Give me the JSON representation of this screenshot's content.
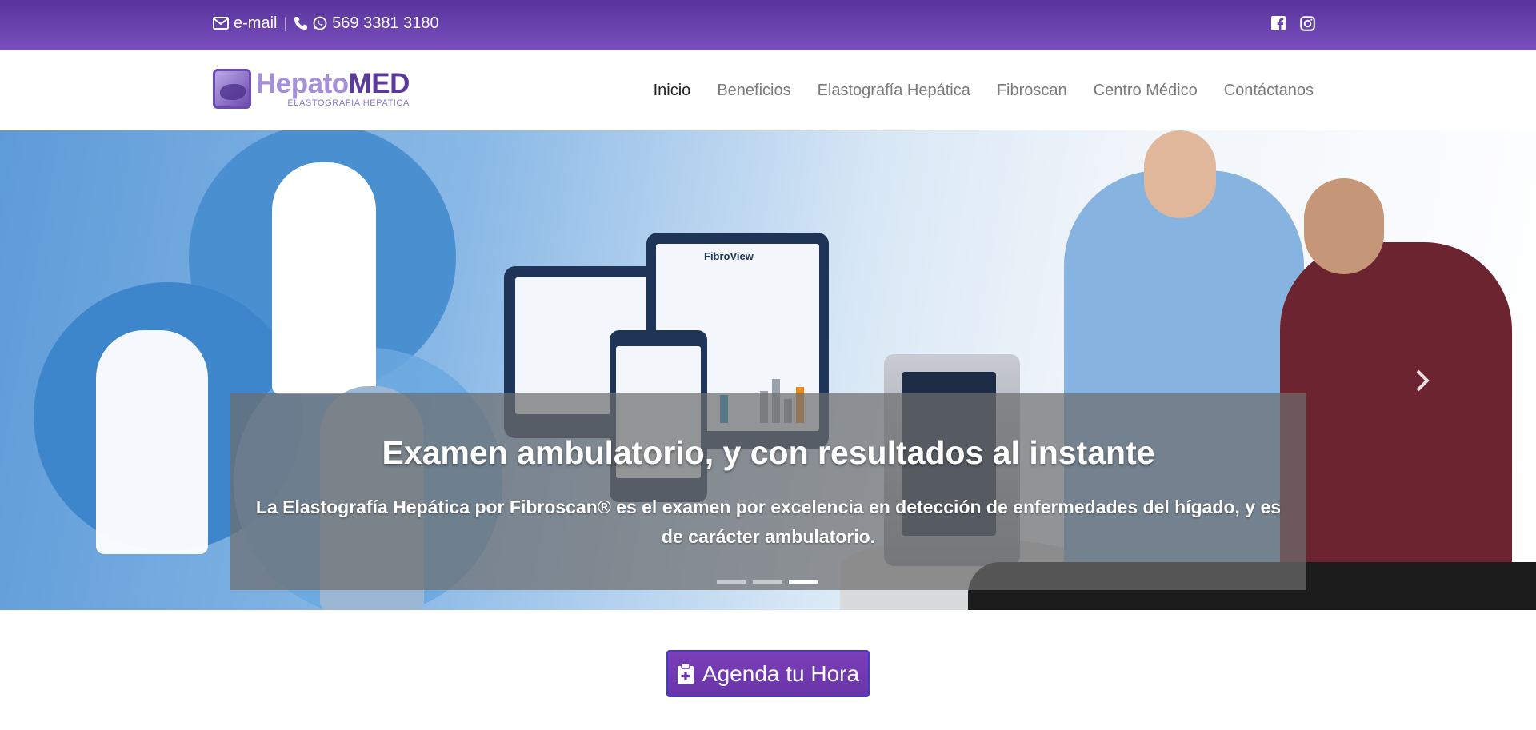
{
  "topbar": {
    "email_label": "e-mail",
    "separator": "|",
    "phone": "569 3381 3180",
    "icons": [
      "envelope-icon",
      "phone-icon",
      "whatsapp-icon",
      "facebook-icon",
      "instagram-icon"
    ]
  },
  "header": {
    "logo": {
      "brand_part1": "Hepato",
      "brand_part2": "MED",
      "tagline": "ELASTOGRAFIA HEPATICA"
    },
    "nav": [
      {
        "label": "Inicio",
        "active": true
      },
      {
        "label": "Beneficios",
        "active": false
      },
      {
        "label": "Elastografía Hepática",
        "active": false
      },
      {
        "label": "Fibroscan",
        "active": false
      },
      {
        "label": "Centro Médico",
        "active": false
      },
      {
        "label": "Contáctanos",
        "active": false
      }
    ]
  },
  "hero": {
    "title": "Examen ambulatorio, y con resultados al instante",
    "text": "La Elastografía Hepática por Fibroscan® es el examen por excelencia en detección de enfermedades del hígado, y es de carácter ambulatorio.",
    "slides_total": 3,
    "active_slide": 3,
    "device_brand": "FibroView"
  },
  "cta": {
    "label": "Agenda tu Hora",
    "icon": "clipboard-plus-icon"
  },
  "colors": {
    "topbar": "#6a44b0",
    "brand_dark": "#5b3a9c",
    "brand_light": "#a48fd8",
    "cta": "#7239b3",
    "cta_border": "#3c3ad8"
  }
}
